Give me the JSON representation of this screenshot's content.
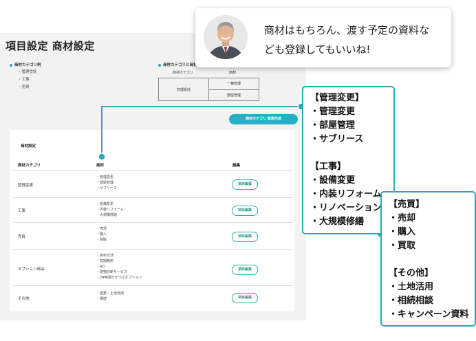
{
  "page_title": "項目設定 商材設定",
  "example": {
    "title": "商材カテゴリ例",
    "items": [
      "・管理受託",
      "・工事",
      "・売買"
    ]
  },
  "mini_table": {
    "title": "商材カテゴリと商材",
    "header_category": "商材カテゴリ",
    "header_product": "商材",
    "category": "管理受託",
    "products": [
      "一棟管理",
      "部屋管理"
    ]
  },
  "new_category_button": "商材カテゴリ 新規作成",
  "card": {
    "title": "商材設定",
    "columns": {
      "category": "商材カテゴリ",
      "product": "商材",
      "edit": "編集"
    },
    "rows": [
      {
        "category": "管理変更",
        "items": [
          "・管理変更",
          "・部屋管理",
          "・サブリース"
        ],
        "edit": "項目編集"
      },
      {
        "category": "工事",
        "items": [
          "・設備変更",
          "・内装リフォーム",
          "・大規模修繕"
        ],
        "edit": "項目編集"
      },
      {
        "category": "売買",
        "items": [
          "・売却",
          "・購入",
          "・買取"
        ],
        "edit": "項目編集"
      },
      {
        "category": "オプション商品",
        "items": [
          "・資料交渉",
          "・初期費用",
          "・AD",
          "・建物診断サービス",
          "・24時間かけつけオプション"
        ],
        "edit": "項目編集"
      },
      {
        "category": "その他",
        "items": [
          "・建築・土地活用",
          "・相続"
        ],
        "edit": "項目編集"
      }
    ]
  },
  "speech": {
    "line1": "商材はもちろん、渡す予定の資料な",
    "line2": "ども登録してもいいね!"
  },
  "callout_1": {
    "lines": [
      "【管理変更】",
      "・管理変更",
      "・部屋管理",
      "・サブリース",
      "",
      "【工事】",
      "・設備変更",
      "・内装リフォーム",
      "・リノベーション",
      "・大規模修繕"
    ]
  },
  "callout_2": {
    "lines": [
      "【売買】",
      "・売却",
      "・購入",
      "・買取",
      "",
      "【その他】",
      "・土地活用",
      "・相続相談",
      "・キャンペーン資料"
    ]
  },
  "colors": {
    "accent": "#2aa8b8",
    "button": "#25b0c6",
    "edit_border": "#2ab0a0"
  }
}
